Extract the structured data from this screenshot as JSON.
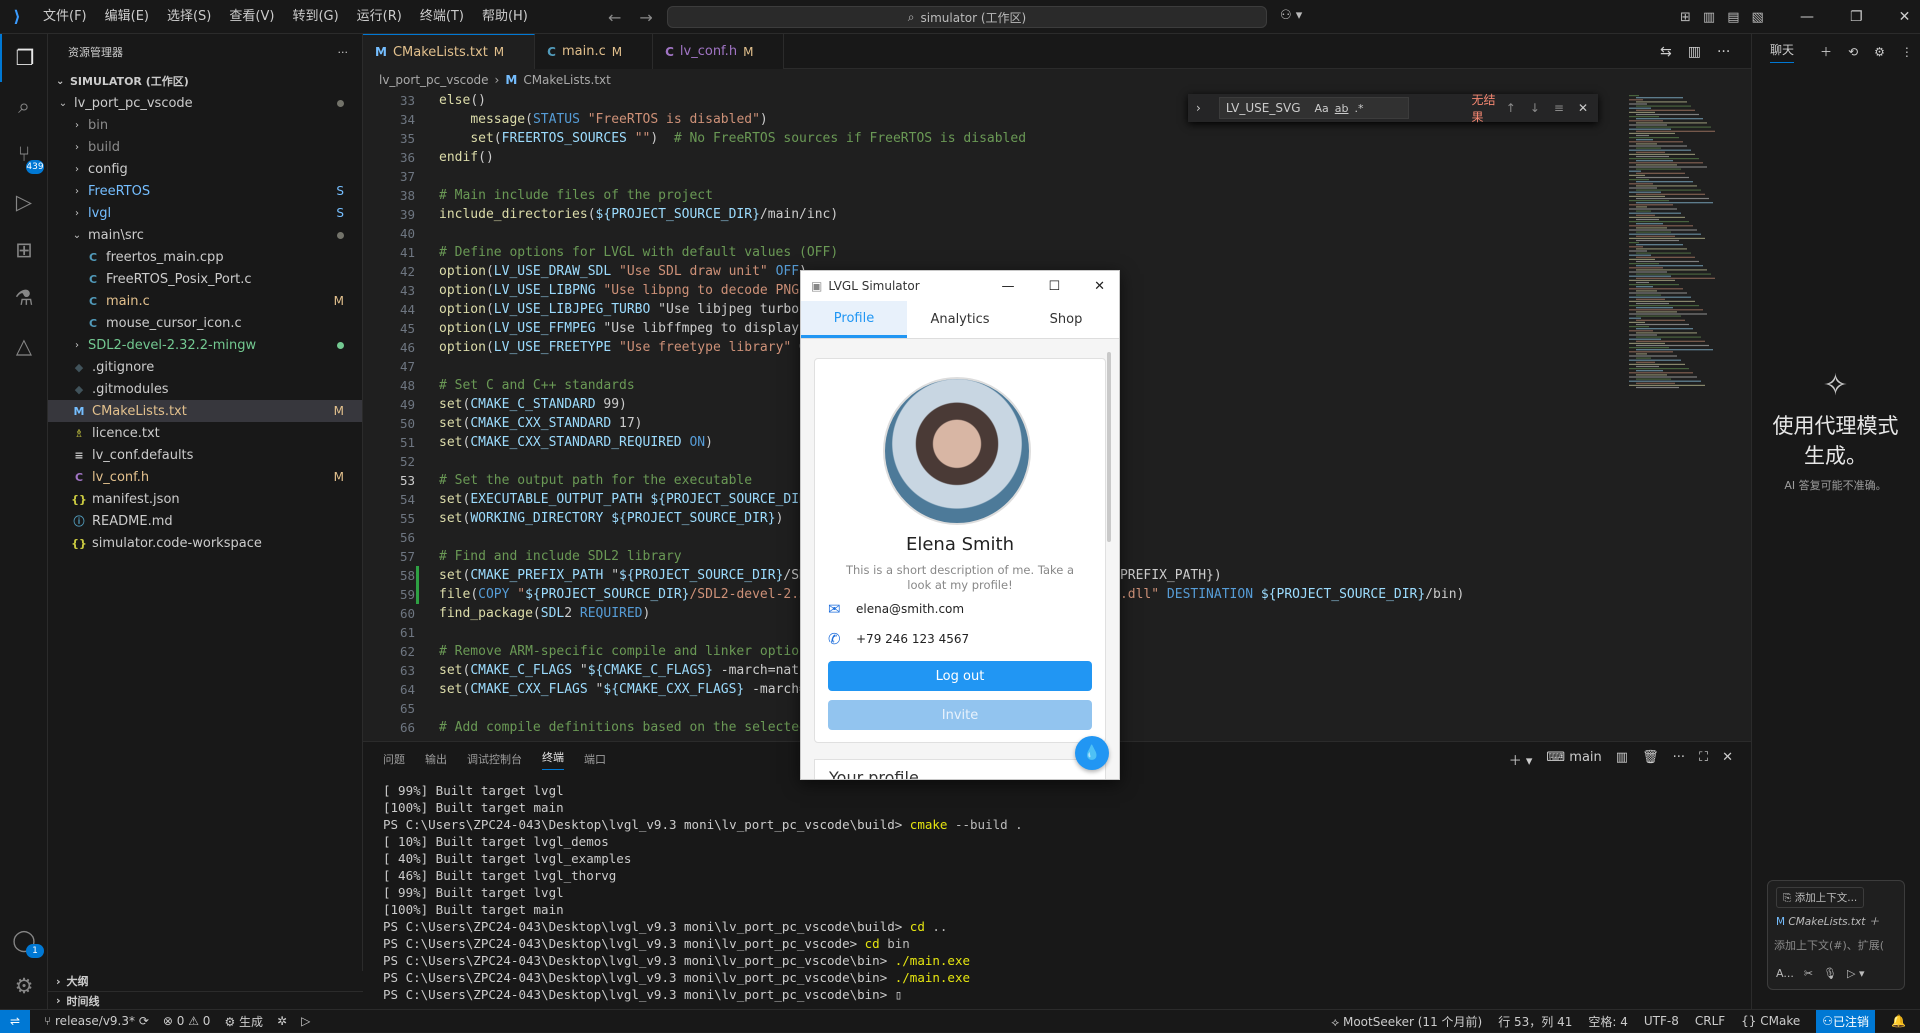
{
  "titlebar": {
    "menu": [
      "文件(F)",
      "编辑(E)",
      "选择(S)",
      "查看(V)",
      "转到(G)",
      "运行(R)",
      "终端(T)",
      "帮助(H)"
    ],
    "search_text": "simulator (工作区)"
  },
  "activity": {
    "scm_badge": "439",
    "account_badge": "1"
  },
  "sidebar": {
    "title": "资源管理器",
    "section": "SIMULATOR (工作区)",
    "items": [
      {
        "label": "lv_port_pc_vscode",
        "badge": "",
        "color": "#cccccc"
      },
      {
        "label": "bin",
        "badge": "",
        "color": "#8b8b8b"
      },
      {
        "label": "build",
        "badge": "",
        "color": "#8b8b8b"
      },
      {
        "label": "config",
        "badge": "",
        "color": "#cccccc"
      },
      {
        "label": "FreeRTOS",
        "badge": "S",
        "color": "#75beff"
      },
      {
        "label": "lvgl",
        "badge": "S",
        "color": "#75beff"
      },
      {
        "label": "main\\src",
        "badge": "",
        "color": "#cccccc"
      },
      {
        "label": "freertos_main.cpp",
        "badge": "",
        "color": "#cccccc"
      },
      {
        "label": "FreeRTOS_Posix_Port.c",
        "badge": "",
        "color": "#cccccc"
      },
      {
        "label": "main.c",
        "badge": "M",
        "color": "#e2c08d"
      },
      {
        "label": "mouse_cursor_icon.c",
        "badge": "",
        "color": "#cccccc"
      },
      {
        "label": "SDL2-devel-2.32.2-mingw",
        "badge": "",
        "color": "#73c991"
      },
      {
        "label": ".gitignore",
        "badge": "",
        "color": "#cccccc"
      },
      {
        "label": ".gitmodules",
        "badge": "",
        "color": "#cccccc"
      },
      {
        "label": "CMakeLists.txt",
        "badge": "M",
        "color": "#e2c08d"
      },
      {
        "label": "licence.txt",
        "badge": "",
        "color": "#cccccc"
      },
      {
        "label": "lv_conf.defaults",
        "badge": "",
        "color": "#cccccc"
      },
      {
        "label": "lv_conf.h",
        "badge": "M",
        "color": "#e2c08d"
      },
      {
        "label": "manifest.json",
        "badge": "",
        "color": "#cccccc"
      },
      {
        "label": "README.md",
        "badge": "",
        "color": "#cccccc"
      },
      {
        "label": "simulator.code-workspace",
        "badge": "",
        "color": "#cccccc"
      }
    ],
    "outline": "大纲",
    "timeline": "时间线"
  },
  "tabs": [
    {
      "label": "CMakeLists.txt",
      "mod": "M"
    },
    {
      "label": "main.c",
      "mod": "M"
    },
    {
      "label": "lv_conf.h",
      "mod": "M"
    }
  ],
  "breadcrumb": {
    "folder": "lv_port_pc_vscode",
    "file": "CMakeLists.txt"
  },
  "find": {
    "query": "LV_USE_SVG",
    "result": "无结果",
    "opt_case": "Aa",
    "opt_word": "ab",
    "opt_regex": ".*"
  },
  "editor": {
    "lines": [
      {
        "n": "33",
        "t": "else()"
      },
      {
        "n": "34",
        "t": "    message(STATUS \"FreeRTOS is disabled\")"
      },
      {
        "n": "35",
        "t": "    set(FREERTOS_SOURCES \"\")  # No FreeRTOS sources if FreeRTOS is disabled"
      },
      {
        "n": "36",
        "t": "endif()"
      },
      {
        "n": "37",
        "t": ""
      },
      {
        "n": "38",
        "t": "# Main include files of the project"
      },
      {
        "n": "39",
        "t": "include_directories(${PROJECT_SOURCE_DIR}/main/inc)"
      },
      {
        "n": "40",
        "t": ""
      },
      {
        "n": "41",
        "t": "# Define options for LVGL with default values (OFF)"
      },
      {
        "n": "42",
        "t": "option(LV_USE_DRAW_SDL \"Use SDL draw unit\" OFF)"
      },
      {
        "n": "43",
        "t": "option(LV_USE_LIBPNG \"Use libpng to decode PNG\""
      },
      {
        "n": "44",
        "t": "option(LV_USE_LIBJPEG_TURBO \"Use libjpeg turbo t"
      },
      {
        "n": "45",
        "t": "option(LV_USE_FFMPEG \"Use libffmpeg to display v"
      },
      {
        "n": "46",
        "t": "option(LV_USE_FREETYPE \"Use freetype library\" OF"
      },
      {
        "n": "47",
        "t": ""
      },
      {
        "n": "48",
        "t": "# Set C and C++ standards"
      },
      {
        "n": "49",
        "t": "set(CMAKE_C_STANDARD 99)"
      },
      {
        "n": "50",
        "t": "set(CMAKE_CXX_STANDARD 17)"
      },
      {
        "n": "51",
        "t": "set(CMAKE_CXX_STANDARD_REQUIRED ON)"
      },
      {
        "n": "52",
        "t": ""
      },
      {
        "n": "53",
        "t": "# Set the output path for the executable"
      },
      {
        "n": "54",
        "t": "set(EXECUTABLE_OUTPUT_PATH ${PROJECT_SOURCE_DIR}"
      },
      {
        "n": "55",
        "t": "set(WORKING_DIRECTORY ${PROJECT_SOURCE_DIR})"
      },
      {
        "n": "56",
        "t": ""
      },
      {
        "n": "57",
        "t": "# Find and include SDL2 library"
      },
      {
        "n": "58",
        "t": "set(CMAKE_PREFIX_PATH \"${PROJECT_SOURCE_DIR}/SDL                                      _PREFIX_PATH})"
      },
      {
        "n": "59",
        "t": "file(COPY \"${PROJECT_SOURCE_DIR}/SDL2-devel-2.32                                 n/SDL2.dll\" DESTINATION ${PROJECT_SOURCE_DIR}/bin)"
      },
      {
        "n": "60",
        "t": "find_package(SDL2 REQUIRED)"
      },
      {
        "n": "61",
        "t": ""
      },
      {
        "n": "62",
        "t": "# Remove ARM-specific compile and linker options"
      },
      {
        "n": "63",
        "t": "set(CMAKE_C_FLAGS \"${CMAKE_C_FLAGS} -march=nativ"
      },
      {
        "n": "64",
        "t": "set(CMAKE_CXX_FLAGS \"${CMAKE_CXX_FLAGS} -march=n"
      },
      {
        "n": "65",
        "t": ""
      },
      {
        "n": "66",
        "t": "# Add compile definitions based on the selected"
      }
    ]
  },
  "panel": {
    "tabs": [
      "问题",
      "输出",
      "调试控制台",
      "终端",
      "端口"
    ],
    "active": "终端",
    "shell": "main"
  },
  "terminal": [
    "[ 99%] Built target lvgl",
    "[100%] Built target main",
    "PS C:\\Users\\ZPC24-043\\Desktop\\lvgl_v9.3 moni\\lv_port_pc_vscode\\build> |cmake| --build .",
    "[ 10%] Built target lvgl_demos",
    "[ 40%] Built target lvgl_examples",
    "[ 46%] Built target lvgl_thorvg",
    "[ 99%] Built target lvgl",
    "[100%] Built target main",
    "PS C:\\Users\\ZPC24-043\\Desktop\\lvgl_v9.3 moni\\lv_port_pc_vscode\\build> |cd| ..",
    "PS C:\\Users\\ZPC24-043\\Desktop\\lvgl_v9.3 moni\\lv_port_pc_vscode> |cd| bin",
    "PS C:\\Users\\ZPC24-043\\Desktop\\lvgl_v9.3 moni\\lv_port_pc_vscode\\bin> |./main.exe|",
    "PS C:\\Users\\ZPC24-043\\Desktop\\lvgl_v9.3 moni\\lv_port_pc_vscode\\bin> |./main.exe|",
    "PS C:\\Users\\ZPC24-043\\Desktop\\lvgl_v9.3 moni\\lv_port_pc_vscode\\bin> ▯"
  ],
  "lvgl": {
    "title": "LVGL Simulator",
    "tabs": [
      "Profile",
      "Analytics",
      "Shop"
    ],
    "name": "Elena Smith",
    "desc": "This is a short description of me. Take a look at my profile!",
    "email": "elena@smith.com",
    "phone": "+79 246 123 4567",
    "logout": "Log out",
    "invite": "Invite",
    "next_card": "Your profile"
  },
  "chat": {
    "tab": "聊天",
    "main1": "使用代理模式",
    "main2": "生成。",
    "sub": "AI 答复可能不准确。",
    "chip": "添加上下文...",
    "file": "CMakeLists.txt",
    "placeholder": "添加上下文(#)、扩展(",
    "mode": "A..."
  },
  "status": {
    "branch": "release/v9.3*",
    "errors": "0",
    "warnings": "0",
    "build": "生成",
    "blame": "MootSeeker (11 个月前)",
    "position": "行 53，列 41",
    "spaces": "空格: 4",
    "encoding": "UTF-8",
    "eol": "CRLF",
    "lang": "CMake",
    "signed": "已注销"
  }
}
